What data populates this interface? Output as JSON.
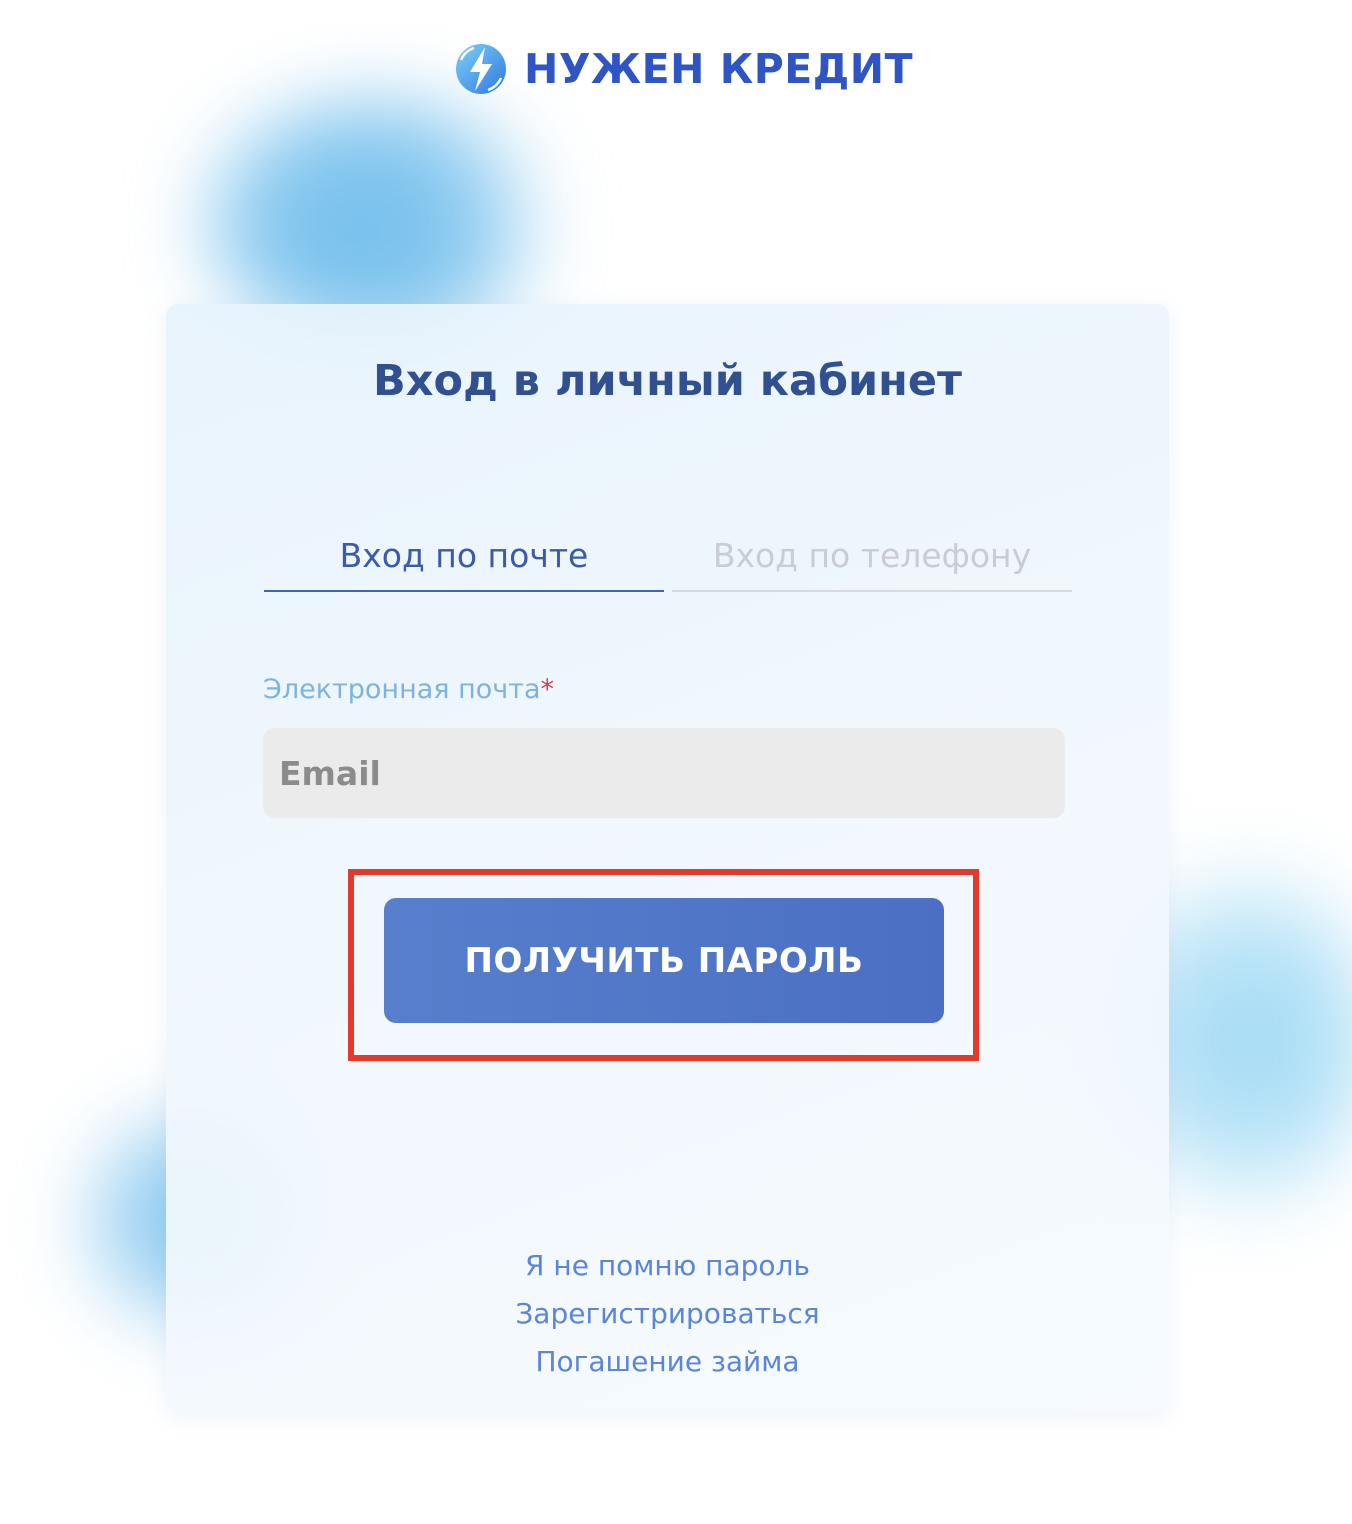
{
  "logo": {
    "text": "НУЖЕН КРЕДИТ",
    "icon": "lightning-circle-icon",
    "color": "#2f55c5"
  },
  "login": {
    "title": "Вход в личный кабинет",
    "tabs": [
      {
        "label": "Вход по почте",
        "active": true
      },
      {
        "label": "Вход по телефону",
        "active": false
      }
    ],
    "email_label": "Электронная почта",
    "required_mark": "*",
    "email_placeholder": "Email",
    "email_value": "",
    "submit_label": "ПОЛУЧИТЬ ПАРОЛЬ",
    "links": [
      "Я не помню пароль",
      "Зарегистрироваться",
      "Погашение займа"
    ]
  },
  "colors": {
    "accent": "#4b6fc4",
    "title": "#31508f",
    "link": "#5b86d6",
    "highlight": "#e33b2b",
    "required": "#e0393b"
  }
}
